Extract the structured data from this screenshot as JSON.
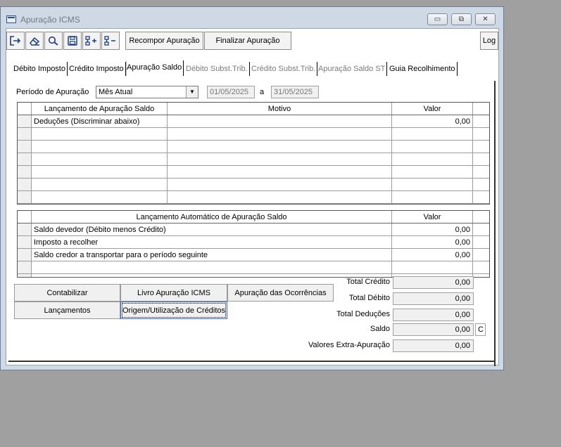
{
  "window": {
    "title": "Apuração ICMS"
  },
  "window_controls": {
    "minimize": "▭",
    "maximize": "⧉",
    "close": "✕"
  },
  "toolbar": {
    "recompor_label": "Recompor Apuração",
    "finalizar_label": "Finalizar Apuração",
    "log_label": "Log"
  },
  "tabs": [
    {
      "label": "Débito Imposto",
      "state": "enabled"
    },
    {
      "label": "Crédito Imposto",
      "state": "enabled"
    },
    {
      "label": "Apuração Saldo",
      "state": "active"
    },
    {
      "label": "Débito Subst.Trib.",
      "state": "disabled"
    },
    {
      "label": "Crédito Subst.Trib.",
      "state": "disabled"
    },
    {
      "label": "Apuração Saldo ST",
      "state": "disabled"
    },
    {
      "label": "Guia Recolhimento",
      "state": "enabled"
    }
  ],
  "periodo": {
    "label": "Período de  Apuração",
    "selected": "Mês Atual",
    "from": "01/05/2025",
    "sep": "a",
    "to": "31/05/2025"
  },
  "grid1": {
    "headers": [
      "Lançamento de Apuração Saldo",
      "Motivo",
      "Valor"
    ],
    "rows": [
      [
        "Deduções (Discriminar abaixo)",
        "",
        "0,00"
      ],
      [
        "",
        "",
        ""
      ],
      [
        "",
        "",
        ""
      ],
      [
        "",
        "",
        ""
      ],
      [
        "",
        "",
        ""
      ],
      [
        "",
        "",
        ""
      ],
      [
        "",
        "",
        ""
      ]
    ]
  },
  "grid2": {
    "headers": [
      "Lançamento Automático de Apuração Saldo",
      "Valor"
    ],
    "rows": [
      [
        "Saldo devedor (Débito menos Crédito)",
        "0,00"
      ],
      [
        "Imposto a recolher",
        "0,00"
      ],
      [
        "Saldo credor a transportar para o período seguinte",
        "0,00"
      ],
      [
        "",
        ""
      ],
      [
        "",
        ""
      ]
    ]
  },
  "buttons": {
    "contabilizar": "Contabilizar",
    "livro": "Livro Apuração ICMS",
    "ocorrencias": "Apuração das Ocorrências",
    "lancamentos": "Lançamentos",
    "origem": "Origem/Utilização de Créditos"
  },
  "totals": {
    "total_credito_label": "Total Crédito",
    "total_credito": "0,00",
    "total_debito_label": "Total Débito",
    "total_debito": "0,00",
    "total_deducoes_label": "Total Deduções",
    "total_deducoes": "0,00",
    "saldo_label": "Saldo",
    "saldo": "0,00",
    "saldo_flag": "C",
    "extra_label": "Valores Extra-Apuração",
    "extra": "0,00"
  },
  "icons": [
    "exit-icon",
    "eraser-icon",
    "search-icon",
    "save-icon",
    "add-row-icon",
    "remove-row-icon"
  ]
}
